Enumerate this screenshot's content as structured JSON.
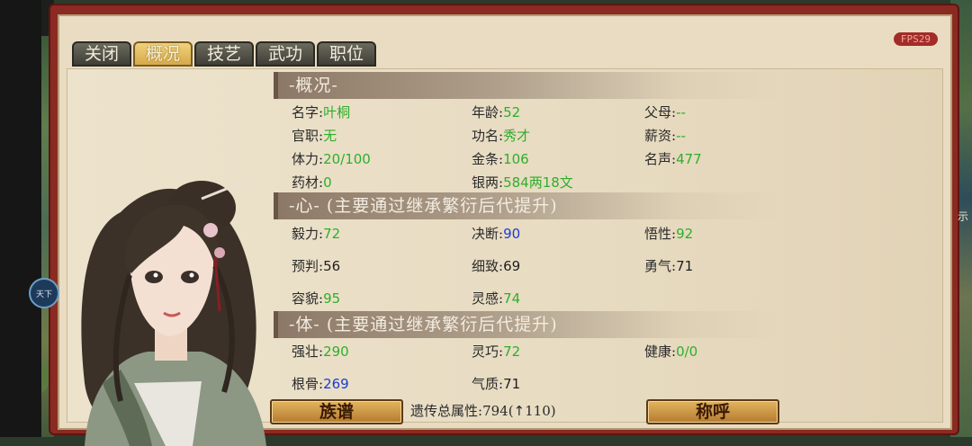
{
  "fps": "FPS29",
  "side_icon": "天下",
  "right_edge_text": "示",
  "tabs": [
    {
      "label": "关闭",
      "active": false
    },
    {
      "label": "概况",
      "active": true
    },
    {
      "label": "技艺",
      "active": false
    },
    {
      "label": "武功",
      "active": false
    },
    {
      "label": "职位",
      "active": false
    }
  ],
  "overview": {
    "header": "-概况-",
    "rows": [
      [
        {
          "label": "名字:",
          "value": "叶桐",
          "color": "green"
        },
        {
          "label": "年龄:",
          "value": "52",
          "color": "green"
        },
        {
          "label": "父母:",
          "value": "--",
          "color": "green"
        }
      ],
      [
        {
          "label": "官职:",
          "value": "无",
          "color": "green"
        },
        {
          "label": "功名:",
          "value": "秀才",
          "color": "green"
        },
        {
          "label": "薪资:",
          "value": "--",
          "color": "green"
        }
      ],
      [
        {
          "label": "体力:",
          "value": "20/100",
          "color": "green"
        },
        {
          "label": "金条:",
          "value": "106",
          "color": "green"
        },
        {
          "label": "名声:",
          "value": "477",
          "color": "green"
        }
      ],
      [
        {
          "label": "药材:",
          "value": "0",
          "color": "green"
        },
        {
          "label": "银两:",
          "value": "584两18文",
          "color": "green"
        }
      ]
    ]
  },
  "heart": {
    "header": "-心-  (主要通过继承繁衍后代提升)",
    "rows": [
      [
        {
          "label": "毅力:",
          "value": "72",
          "color": "green"
        },
        {
          "label": "决断:",
          "value": "90",
          "color": "blue"
        },
        {
          "label": "悟性:",
          "value": "92",
          "color": "green"
        }
      ],
      [
        {
          "label": "预判:",
          "value": "56",
          "color": "black"
        },
        {
          "label": "细致:",
          "value": "69",
          "color": "black"
        },
        {
          "label": "勇气:",
          "value": "71",
          "color": "black"
        }
      ],
      [
        {
          "label": "容貌:",
          "value": "95",
          "color": "green"
        },
        {
          "label": "灵感:",
          "value": "74",
          "color": "green"
        }
      ]
    ]
  },
  "body": {
    "header": "-体-  (主要通过继承繁衍后代提升)",
    "rows": [
      [
        {
          "label": "强壮:",
          "value": "290",
          "color": "green"
        },
        {
          "label": "灵巧:",
          "value": "72",
          "color": "green"
        },
        {
          "label": "健康:",
          "value": "0/0",
          "color": "green"
        }
      ],
      [
        {
          "label": "根骨:",
          "value": "269",
          "color": "blue"
        },
        {
          "label": "气质:",
          "value": "71",
          "color": "black"
        }
      ]
    ]
  },
  "footer": {
    "genealogy_button": "族谱",
    "total_label": "遗传总属性:",
    "total_value": "794(",
    "total_delta": "110)",
    "title_button": "称呼"
  },
  "colors": {
    "green": "#2fae2c",
    "blue": "#1a3bd1",
    "black": "#1f1f1f",
    "panel_red": "#8b2a22",
    "tab_gold": "#f1d27a"
  },
  "icons": [
    "arrow-up-icon",
    "character-portrait"
  ]
}
